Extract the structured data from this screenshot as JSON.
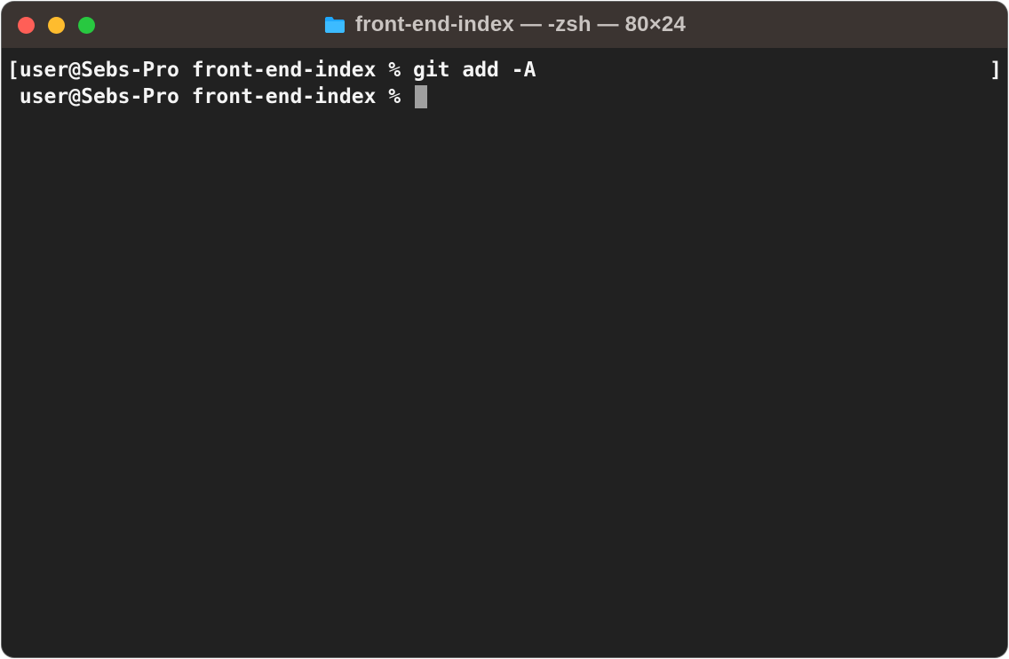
{
  "window": {
    "title": "front-end-index — -zsh — 80×24"
  },
  "terminal": {
    "line1_left_bracket": "[",
    "line1_prompt": "user@Sebs-Pro front-end-index % ",
    "line1_command": "git add -A",
    "line1_right_bracket": "]",
    "line2_indent": " ",
    "line2_prompt": "user@Sebs-Pro front-end-index % "
  }
}
